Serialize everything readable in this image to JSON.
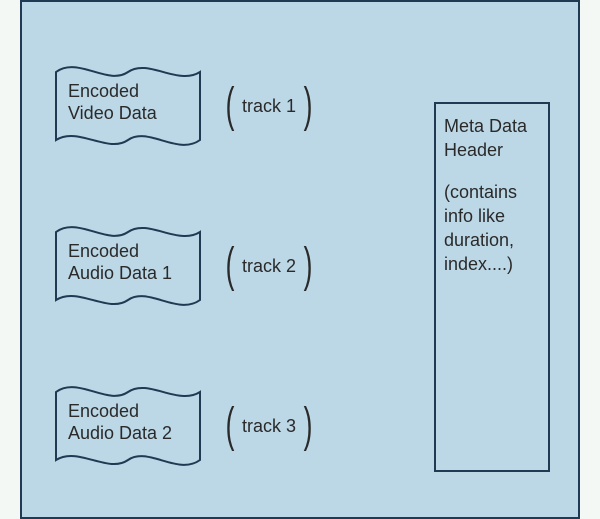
{
  "tracks": [
    {
      "doc_label": "Encoded Video Data",
      "track_label": "track 1"
    },
    {
      "doc_label": "Encoded Audio Data 1",
      "track_label": "track 2"
    },
    {
      "doc_label": "Encoded Audio Data 2",
      "track_label": "track 3"
    }
  ],
  "meta": {
    "title": "Meta Data Header",
    "detail": "(contains info like duration, index....)"
  }
}
